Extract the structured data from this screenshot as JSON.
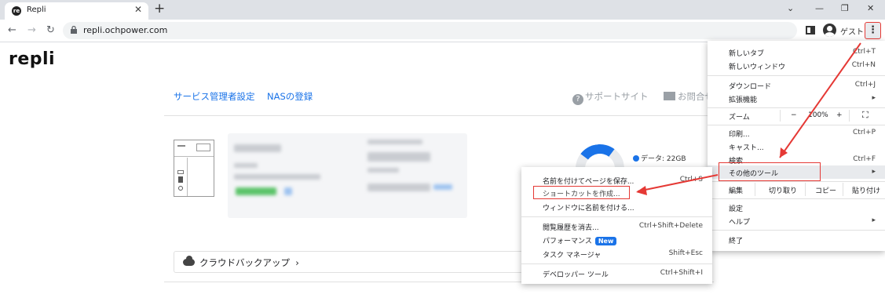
{
  "browser": {
    "tab_title": "Repli",
    "url": "repli.ochpower.com",
    "profile_label": "ゲスト"
  },
  "site": {
    "logo": "repli",
    "nav": [
      "サービス管理者設定",
      "NASの登録"
    ],
    "support_link": "サポートサイト",
    "contact_link": "お問合せ",
    "donut_legend": "データ: 22GB",
    "cloud_backup": "クラウドバックアップ"
  },
  "chrome_menu": {
    "new_tab": {
      "label": "新しいタブ",
      "shortcut": "Ctrl+T"
    },
    "new_window": {
      "label": "新しいウィンドウ",
      "shortcut": "Ctrl+N"
    },
    "downloads": {
      "label": "ダウンロード",
      "shortcut": "Ctrl+J"
    },
    "extensions": {
      "label": "拡張機能"
    },
    "zoom": {
      "label": "ズーム",
      "minus": "−",
      "value": "100%",
      "plus": "+"
    },
    "print": {
      "label": "印刷...",
      "shortcut": "Ctrl+P"
    },
    "cast": {
      "label": "キャスト..."
    },
    "find": {
      "label": "検索...",
      "shortcut": "Ctrl+F"
    },
    "more_tools": {
      "label": "その他のツール"
    },
    "edit": {
      "label": "編集",
      "cut": "切り取り",
      "copy": "コピー",
      "paste": "貼り付け"
    },
    "settings": {
      "label": "設定"
    },
    "help": {
      "label": "ヘルプ"
    },
    "exit": {
      "label": "終了"
    }
  },
  "more_tools_menu": {
    "save_page": {
      "label": "名前を付けてページを保存...",
      "shortcut": "Ctrl+S"
    },
    "create_shortcut": {
      "label": "ショートカットを作成..."
    },
    "name_window": {
      "label": "ウィンドウに名前を付ける..."
    },
    "clear_history": {
      "label": "閲覧履歴を消去...",
      "shortcut": "Ctrl+Shift+Delete"
    },
    "performance": {
      "label": "パフォーマンス",
      "badge": "New"
    },
    "task_manager": {
      "label": "タスク マネージャ",
      "shortcut": "Shift+Esc"
    },
    "dev_tools": {
      "label": "デベロッパー ツール",
      "shortcut": "Ctrl+Shift+I"
    }
  },
  "colors": {
    "annotation": "#e53935",
    "accent": "#1a73e8"
  }
}
